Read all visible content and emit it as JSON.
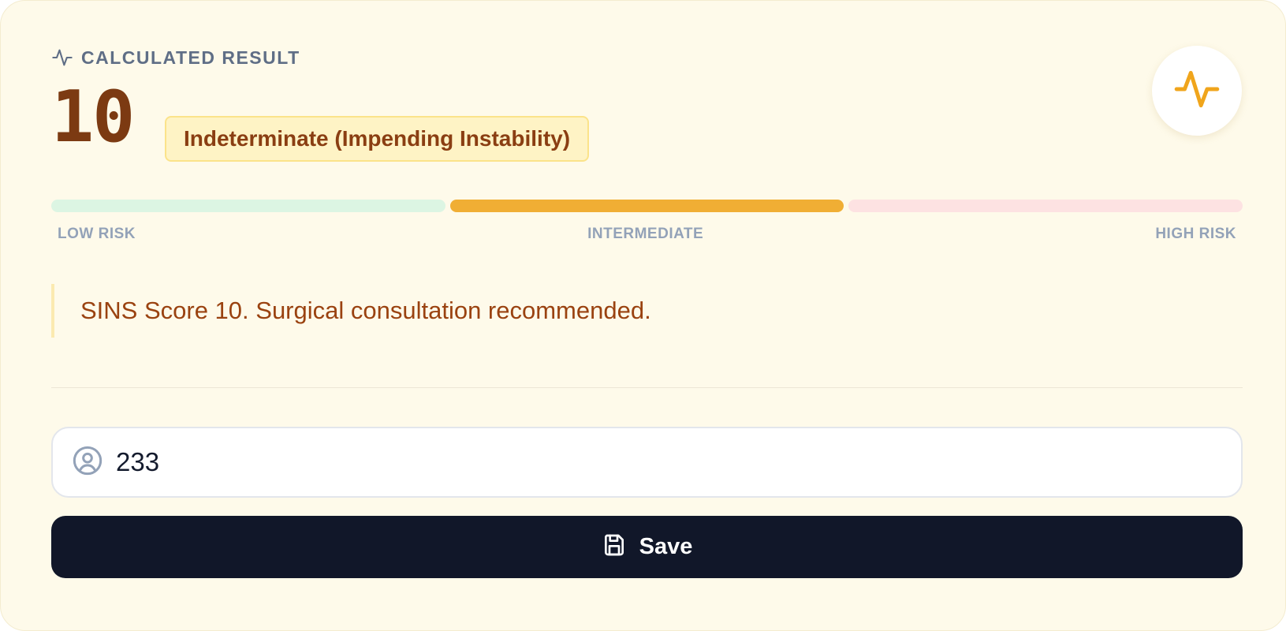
{
  "result": {
    "header_label": "CALCULATED RESULT",
    "header_icon": "activity-icon",
    "score": "10",
    "category": "Indeterminate (Impending Instability)",
    "pulse_icon": "activity-icon"
  },
  "risk_scale": {
    "segments": [
      {
        "name": "low",
        "color": "#dcf5e3",
        "active": false
      },
      {
        "name": "intermediate",
        "color": "#f0ae34",
        "active": true
      },
      {
        "name": "high",
        "color": "#fde2e2",
        "active": false
      }
    ],
    "labels": {
      "low": "LOW RISK",
      "intermediate": "INTERMEDIATE",
      "high": "HIGH RISK"
    }
  },
  "interpretation": "SINS Score 10. Surgical consultation recommended.",
  "patient_id": {
    "value": "233",
    "icon": "user-circle-icon"
  },
  "save_button": {
    "label": "Save",
    "icon": "save-icon"
  },
  "colors": {
    "card_bg": "#fefaea",
    "score_color": "#7c3a12",
    "badge_bg": "#fef3c5",
    "badge_border": "#fbe38a",
    "accent": "#f0ae34",
    "button_bg": "#111729"
  }
}
